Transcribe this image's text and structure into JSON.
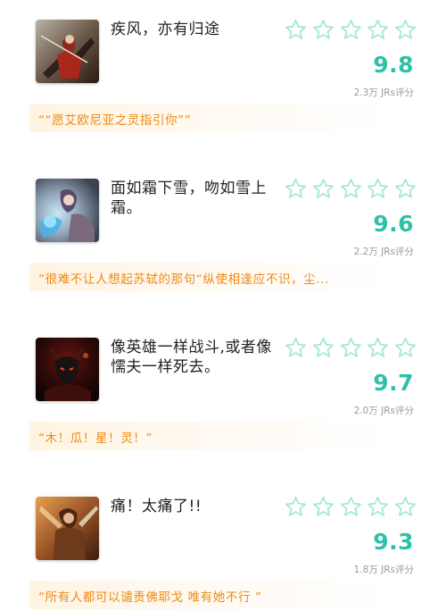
{
  "accent_color": "#2fc1a7",
  "quote_color": "#ee8a14",
  "star_icon": "star-outline-icon",
  "cards": [
    {
      "title": "疾风，亦有归途",
      "score": "9.8",
      "count": "2.3万 JRs评分",
      "quote": "““愿艾欧尼亚之灵指引你””",
      "stars_filled": 0
    },
    {
      "title": "面如霜下雪，吻如雪上霜。",
      "score": "9.6",
      "count": "2.2万 JRs评分",
      "quote": "“很难不让人想起苏轼的那句“纵使相逢应不识，尘...",
      "stars_filled": 0
    },
    {
      "title": "像英雄一样战斗,或者像懦夫一样死去。",
      "score": "9.7",
      "count": "2.0万 JRs评分",
      "quote": "“木！瓜！星！灵！”",
      "stars_filled": 0
    },
    {
      "title": "痛！太痛了!!",
      "score": "9.3",
      "count": "1.8万 JRs评分",
      "quote": "“所有人都可以谴责佛耶戈 唯有她不行 ”",
      "stars_filled": 0
    }
  ]
}
